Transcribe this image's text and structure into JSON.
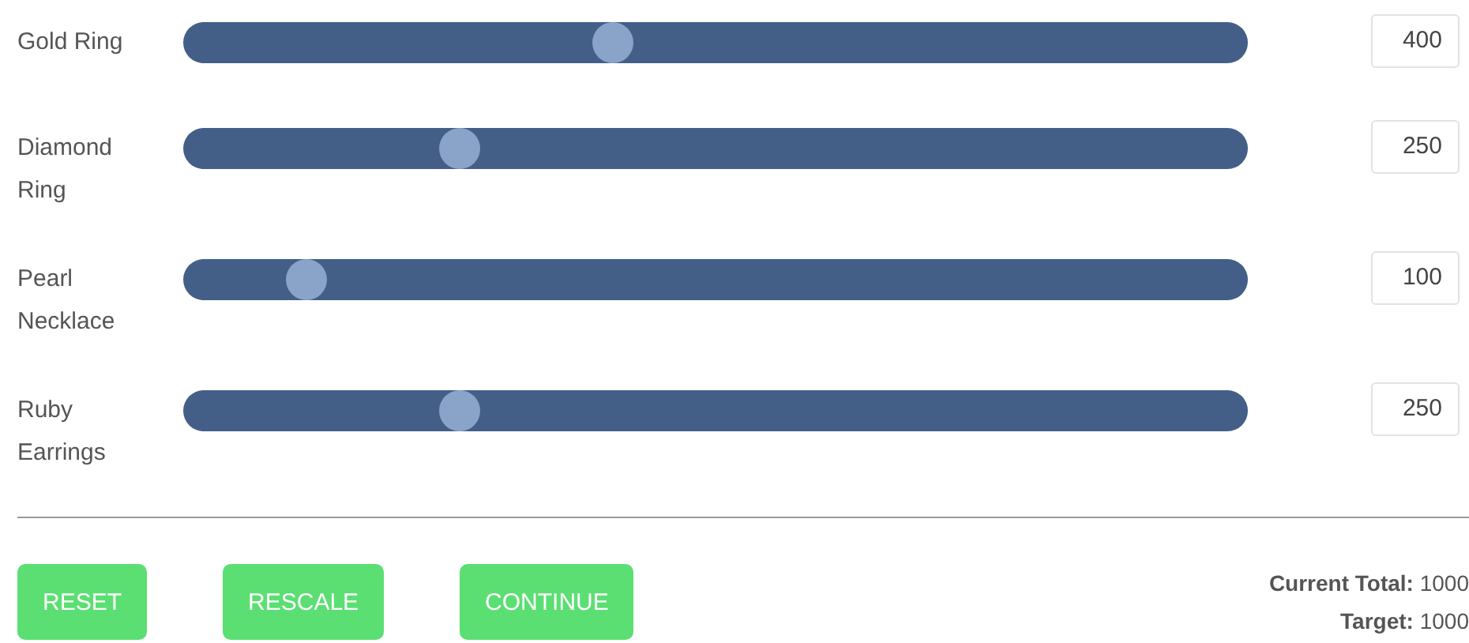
{
  "items": [
    {
      "label": "Gold Ring",
      "level": 0.4,
      "value": "400"
    },
    {
      "label": "Diamond Ring",
      "level": 0.25,
      "value": "250"
    },
    {
      "label": "Pearl Necklace",
      "level": 0.1,
      "value": "100"
    },
    {
      "label": "Ruby Earrings",
      "level": 0.25,
      "value": "250"
    }
  ],
  "buttons": [
    "RESET",
    "RESCALE",
    "CONTINUE"
  ],
  "totals": [
    {
      "label": "Current Total:",
      "value": "1000"
    },
    {
      "label": "Target:",
      "value": "1000"
    }
  ]
}
